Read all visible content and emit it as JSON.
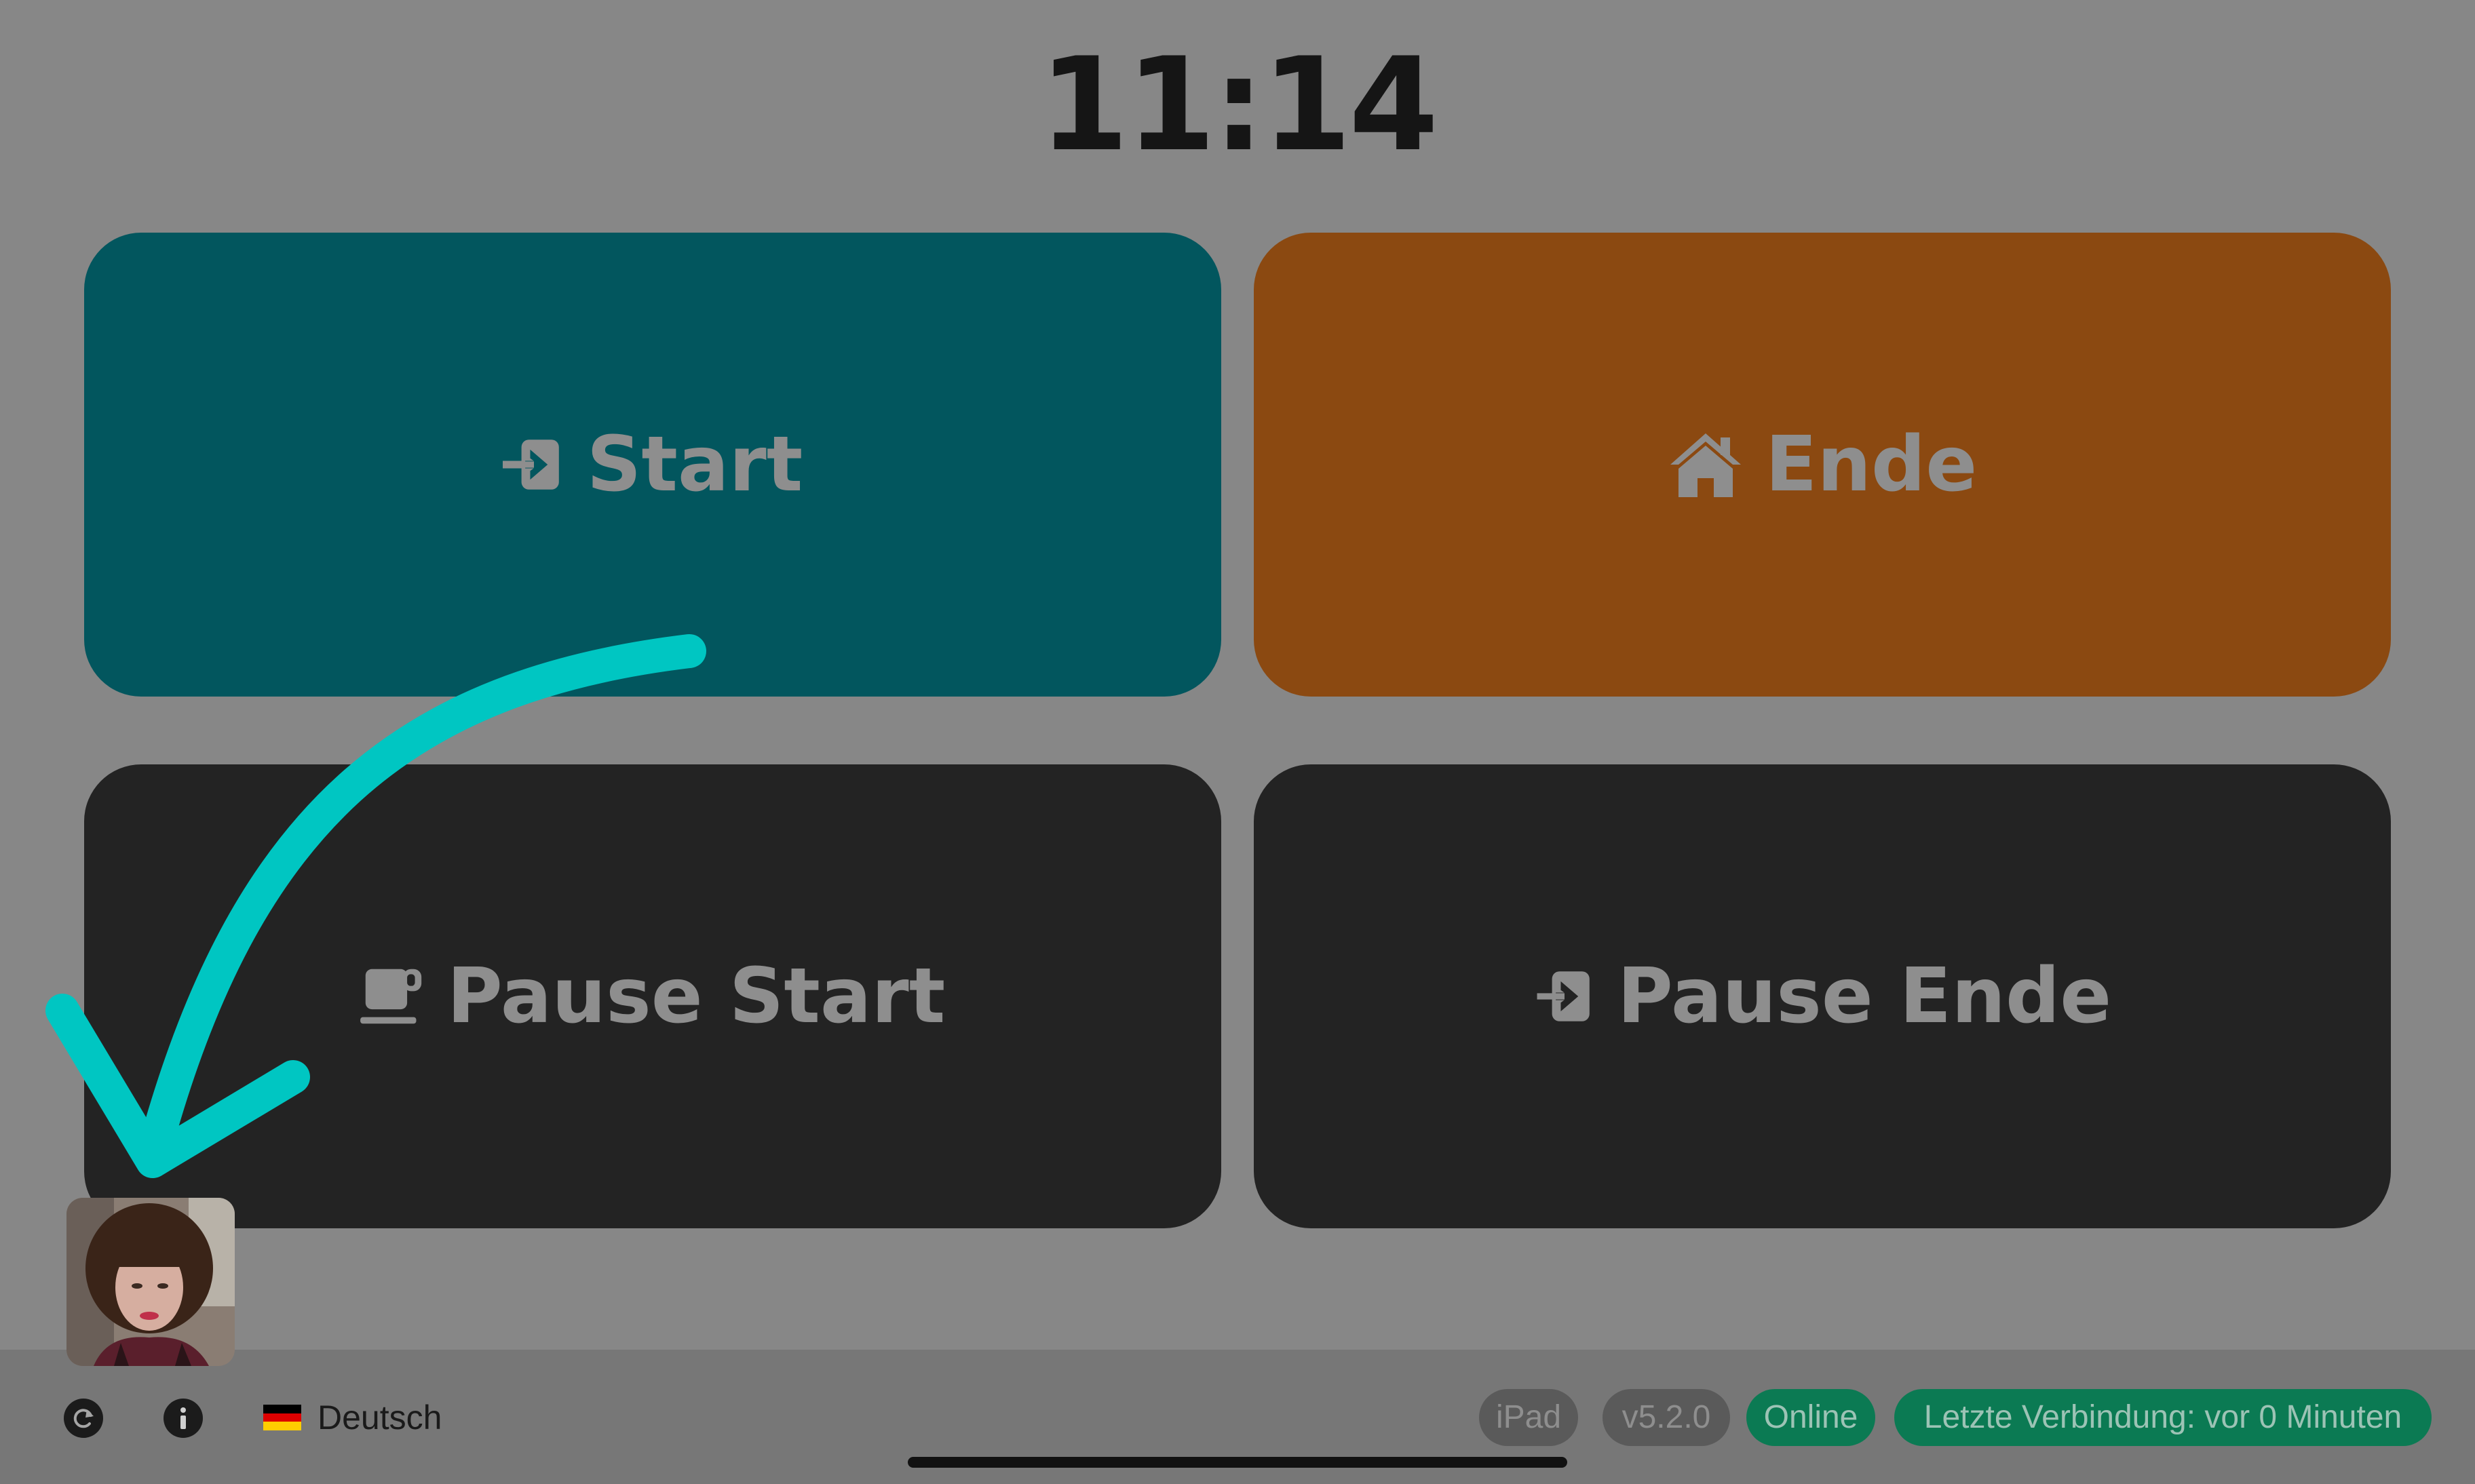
{
  "clock": "11:14",
  "tiles": {
    "start": {
      "label": "Start",
      "icon": "sign-in-icon",
      "color": "#02565e"
    },
    "end": {
      "label": "Ende",
      "icon": "home-icon",
      "color": "#8b4911"
    },
    "pause_start": {
      "label": "Pause Start",
      "icon": "coffee-cup-icon",
      "color": "#232323"
    },
    "pause_end": {
      "label": "Pause Ende",
      "icon": "sign-in-icon",
      "color": "#232323"
    }
  },
  "footer": {
    "refresh_icon": "refresh-icon",
    "info_icon": "info-icon",
    "language": "Deutsch",
    "language_flag": "germany-flag",
    "device": "iPad",
    "version": "v5.2.0",
    "status": "Online",
    "last_connection": "Letzte Verbindung: vor 0 Minuten"
  },
  "colors": {
    "overlay_background": "#878787",
    "footer_background": "#777777",
    "status_green": "#0b7a53",
    "badge_gray": "#5a5a5a",
    "annotation_arrow": "#00c6c2"
  }
}
